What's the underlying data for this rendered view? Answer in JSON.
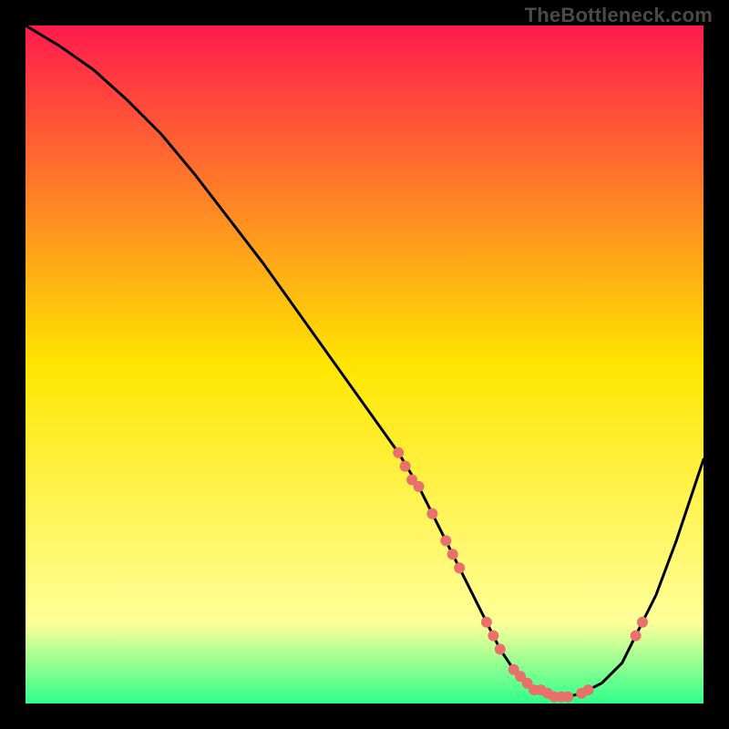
{
  "watermark": "TheBottleneck.com",
  "chart_data": {
    "type": "line",
    "title": "",
    "xlabel": "",
    "ylabel": "",
    "xlim": [
      0,
      100
    ],
    "ylim": [
      0,
      100
    ],
    "background_gradient": {
      "top_color": "#ff1a4d",
      "mid_color": "#ffe600",
      "near_bottom_color": "#ffff99",
      "bottom_color": "#2eff8a"
    },
    "series": [
      {
        "name": "bottleneck-curve",
        "type": "line",
        "color": "#000000",
        "x": [
          0,
          5,
          10,
          15,
          20,
          25,
          30,
          35,
          40,
          45,
          50,
          55,
          58,
          60,
          62,
          65,
          68,
          70,
          72,
          75,
          78,
          80,
          82,
          85,
          88,
          90,
          93,
          96,
          100
        ],
        "values": [
          100,
          97,
          93.5,
          89,
          84,
          78,
          71.5,
          65,
          58,
          51,
          44,
          37,
          32,
          28,
          24,
          18,
          12,
          8,
          5,
          2,
          1,
          1,
          1.5,
          3,
          6,
          10,
          16,
          24,
          36
        ]
      },
      {
        "name": "data-points",
        "type": "scatter",
        "color": "#e9716b",
        "x": [
          55,
          56,
          57,
          58,
          60,
          62,
          63,
          64,
          68,
          69,
          70,
          72,
          73,
          74,
          75,
          76,
          77,
          78,
          79,
          80,
          82,
          83,
          90,
          91
        ],
        "values": [
          37,
          35,
          33,
          32,
          28,
          24,
          22,
          20,
          12,
          10,
          8,
          5,
          4,
          3,
          2,
          2,
          1.5,
          1,
          1,
          1,
          1.5,
          2,
          10,
          12
        ]
      }
    ]
  }
}
